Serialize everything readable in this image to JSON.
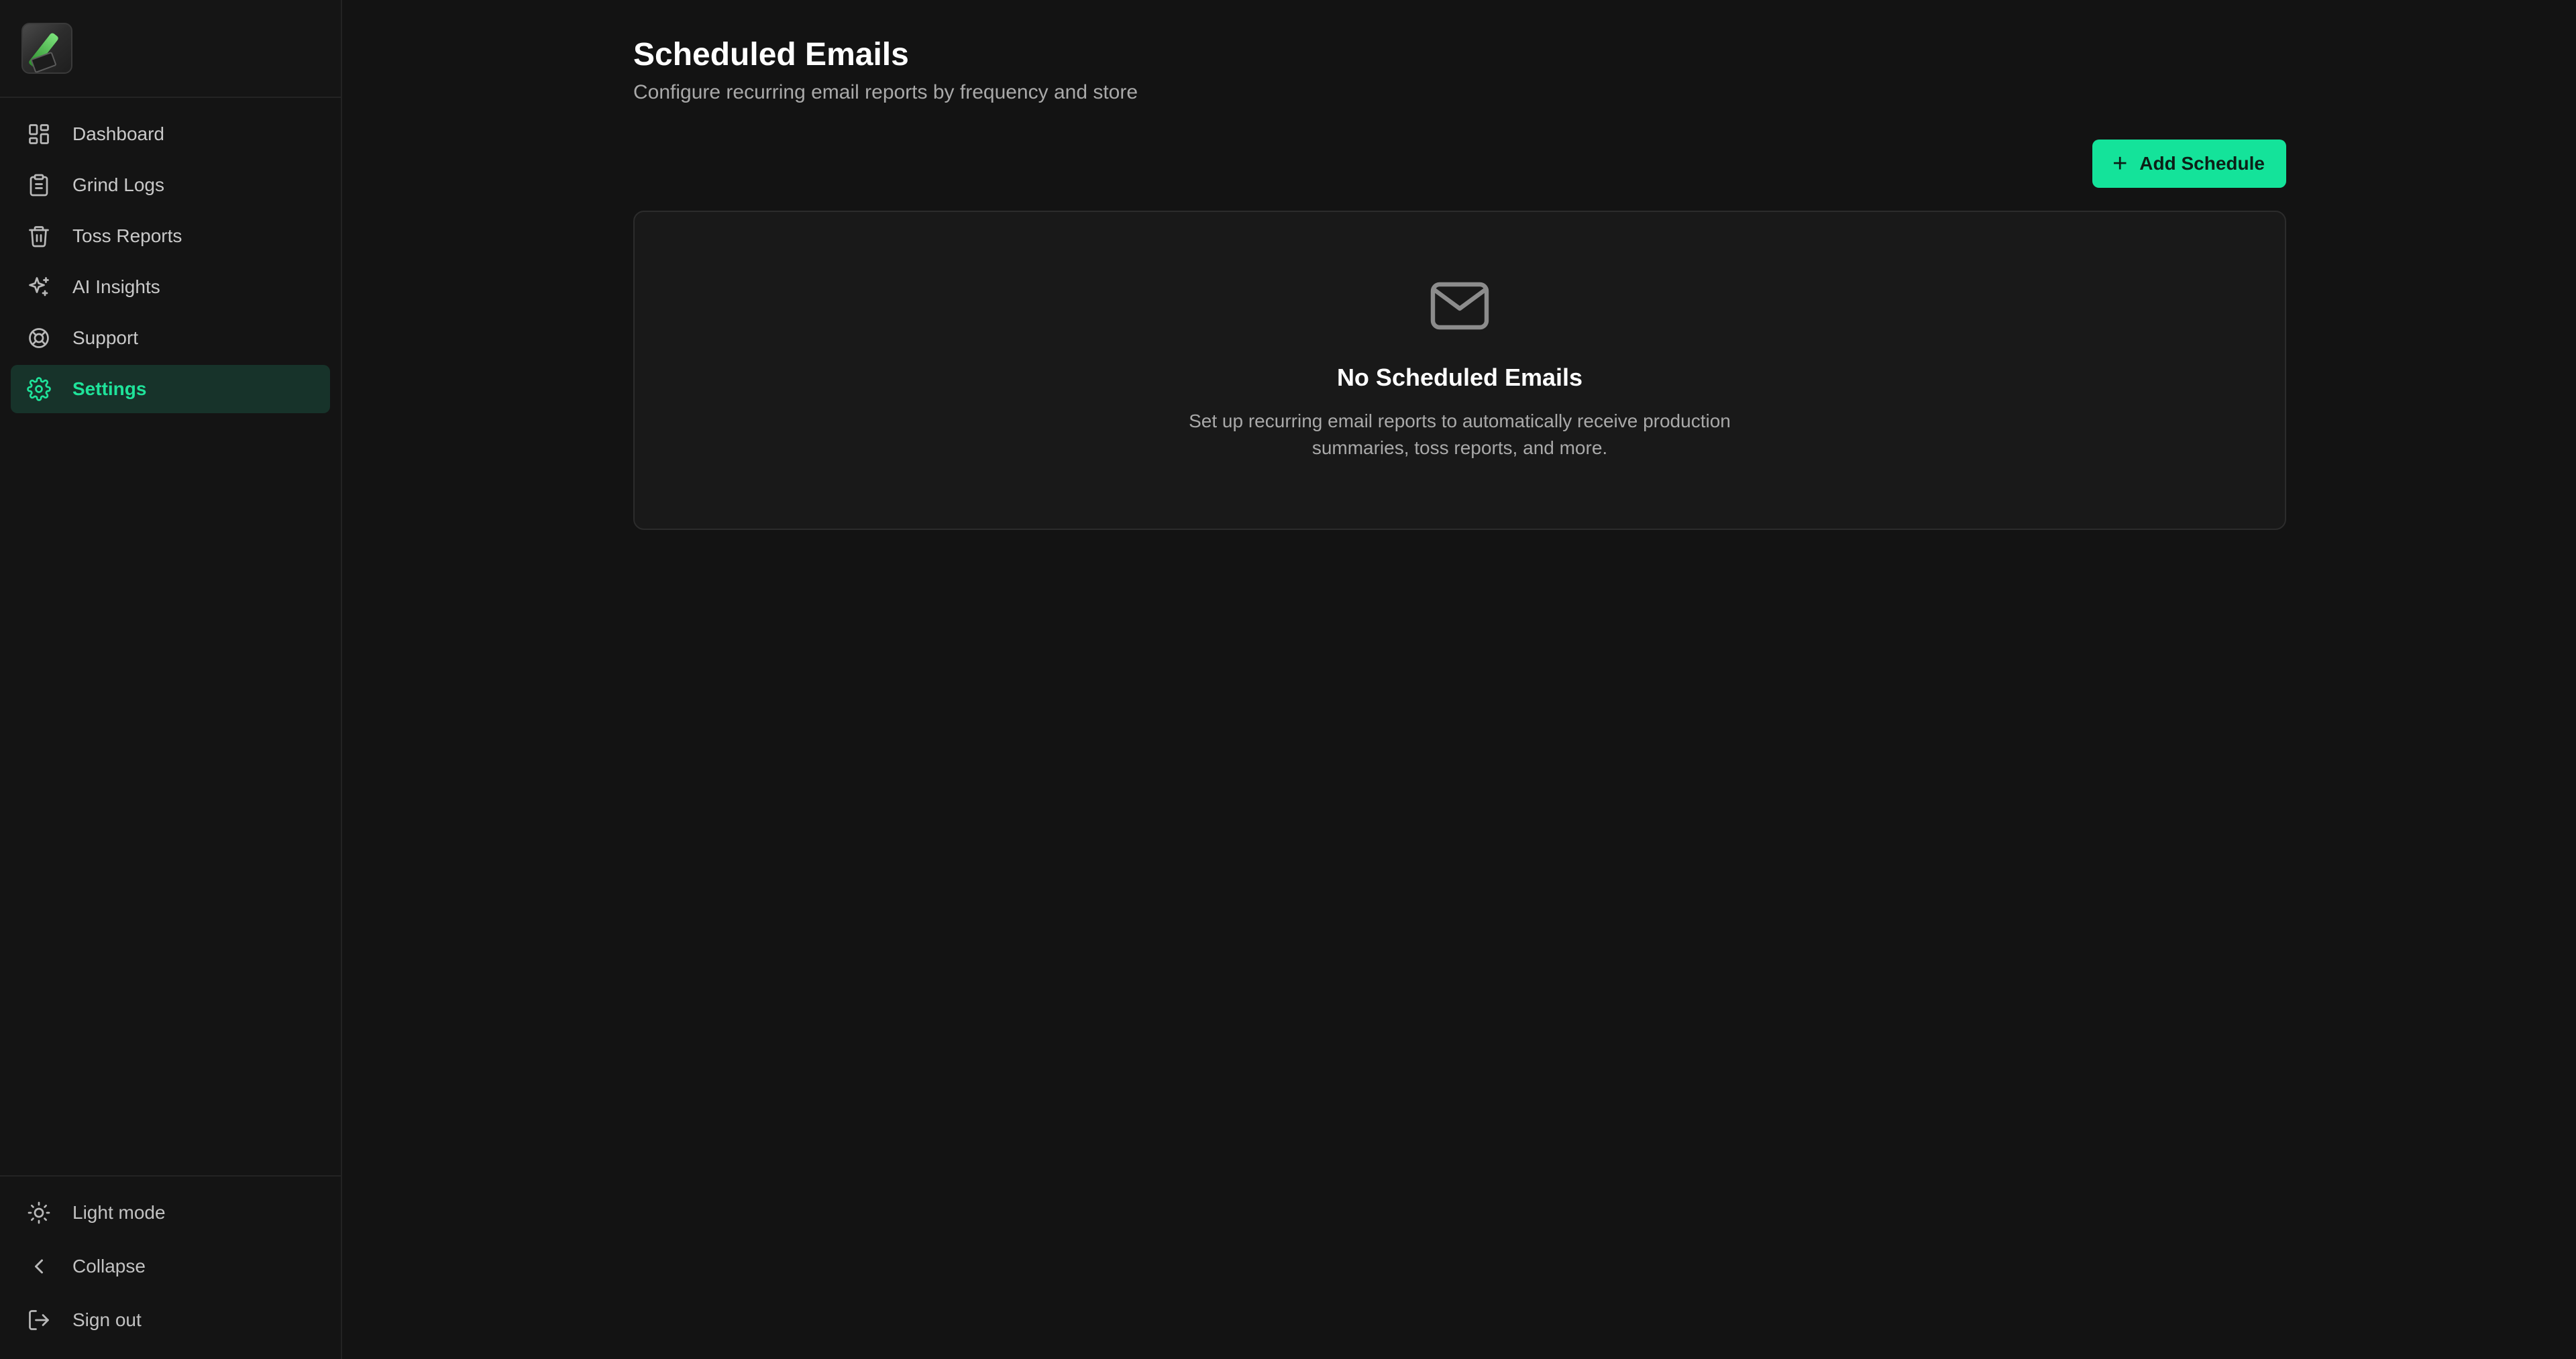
{
  "sidebar": {
    "logo_icon": "app-logo",
    "items": [
      {
        "label": "Dashboard",
        "icon": "dashboard-icon",
        "active": false
      },
      {
        "label": "Grind Logs",
        "icon": "clipboard-icon",
        "active": false
      },
      {
        "label": "Toss Reports",
        "icon": "trash-icon",
        "active": false
      },
      {
        "label": "AI Insights",
        "icon": "sparkles-icon",
        "active": false
      },
      {
        "label": "Support",
        "icon": "lifebuoy-icon",
        "active": false
      },
      {
        "label": "Settings",
        "icon": "gear-icon",
        "active": true
      }
    ],
    "bottom": {
      "light_mode": "Light mode",
      "collapse": "Collapse",
      "sign_out": "Sign out"
    }
  },
  "main": {
    "title": "Scheduled Emails",
    "subtitle": "Configure recurring email reports by frequency and store",
    "add_button_label": "Add Schedule",
    "empty_state": {
      "icon": "mail-icon",
      "title": "No Scheduled Emails",
      "description": "Set up recurring email reports to automatically receive production summaries, toss reports, and more."
    }
  },
  "colors": {
    "accent": "#14e39a",
    "background": "#131313",
    "sidebar": "#141414",
    "card": "#191919",
    "active_nav_bg": "#17332a"
  }
}
